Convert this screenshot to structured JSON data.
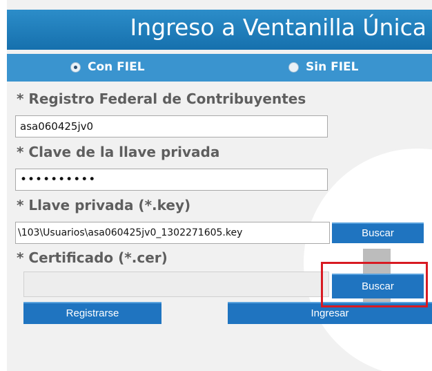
{
  "header": {
    "title": "Ingreso a Ventanilla Única"
  },
  "auth_options": [
    {
      "label": "Con FIEL",
      "selected": true
    },
    {
      "label": "Sin FIEL",
      "selected": false
    }
  ],
  "form": {
    "rfc": {
      "label": "* Registro Federal de Contribuyentes",
      "value": "asa060425jv0"
    },
    "password": {
      "label": "* Clave de la llave privada",
      "value": "••••••••••"
    },
    "private_key": {
      "label": "* Llave privada (*.key)",
      "value": "\\103\\Usuarios\\asa060425jv0_1302271605.key",
      "button_label": "Buscar"
    },
    "certificate": {
      "label": "* Certificado (*.cer)",
      "value": "",
      "button_label": "Buscar"
    }
  },
  "actions": {
    "register_label": "Registrarse",
    "login_label": "Ingresar"
  },
  "colors": {
    "header_blue": "#1670ad",
    "button_blue": "#1f74c0",
    "highlight_red": "#d81a22"
  }
}
